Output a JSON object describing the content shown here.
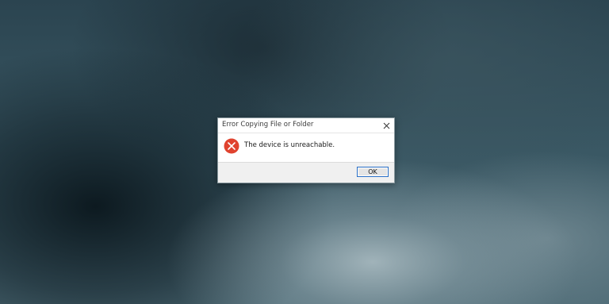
{
  "dialog": {
    "title": "Error Copying File or Folder",
    "message": "The device is unreachable.",
    "ok_label": "OK",
    "close_icon": "close-icon",
    "status_icon": "error-icon"
  },
  "colors": {
    "error_red": "#e0432f",
    "button_focus_border": "#2a6fc6"
  }
}
